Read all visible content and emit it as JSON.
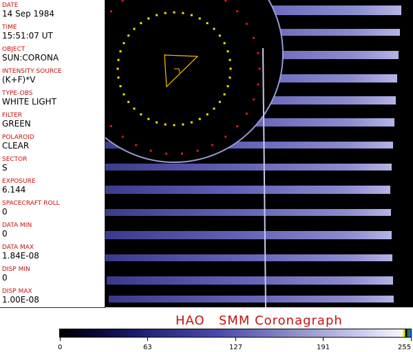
{
  "info_panel": [
    {
      "label": "DATE",
      "value": "14 Sep 1984"
    },
    {
      "label": "TIME",
      "value": "15:51:07 UT"
    },
    {
      "label": "OBJECT",
      "value": "SUN:CORONA"
    },
    {
      "label": "INTENSITY SOURCE",
      "value": "(K+F)*V"
    },
    {
      "label": "TYPE-OBS",
      "value": "WHITE LIGHT"
    },
    {
      "label": "FILTER",
      "value": "GREEN"
    },
    {
      "label": "POLAROID",
      "value": "CLEAR"
    },
    {
      "label": "SECTOR",
      "value": "S"
    },
    {
      "label": "EXPOSURE",
      "value": "6.144"
    },
    {
      "label": "SPACECRAFT ROLL",
      "value": "0"
    },
    {
      "label": "DATA MIN",
      "value": "0"
    },
    {
      "label": "DATA MAX",
      "value": "1.84E-08"
    },
    {
      "label": "DISP MIN",
      "value": "0"
    },
    {
      "label": "DISP MAX",
      "value": "1.00E-08"
    }
  ],
  "title": "HAO   SMM Coronagraph",
  "colorbar": {
    "ticks": [
      "0",
      "63",
      "127",
      "191",
      "255"
    ]
  },
  "colors": {
    "label": "#c81010",
    "image_tint": "#5a5ab4"
  }
}
